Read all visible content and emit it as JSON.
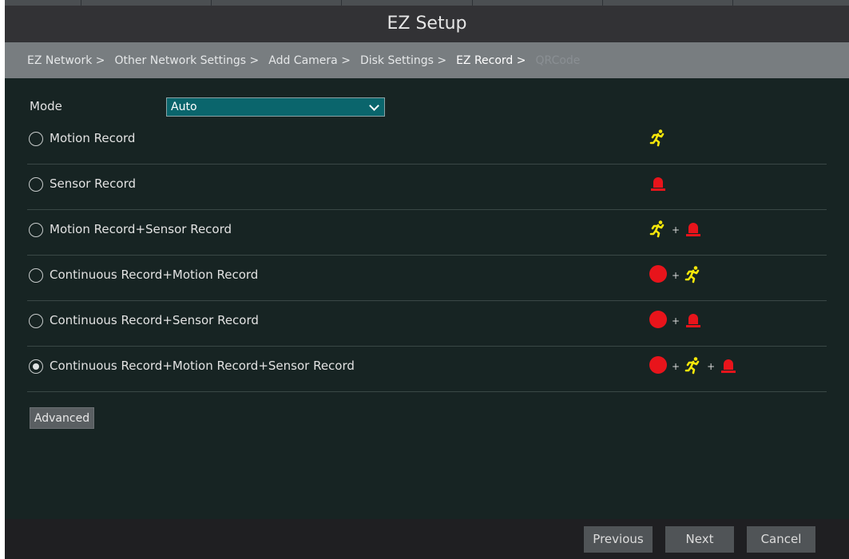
{
  "window": {
    "title": "EZ Setup"
  },
  "breadcrumbs": [
    {
      "label": "EZ Network >",
      "state": "done"
    },
    {
      "label": "Other Network Settings >",
      "state": "done"
    },
    {
      "label": "Add Camera >",
      "state": "done"
    },
    {
      "label": "Disk Settings >",
      "state": "done"
    },
    {
      "label": "EZ Record >",
      "state": "current"
    },
    {
      "label": "QRCode",
      "state": "future"
    }
  ],
  "mode": {
    "label": "Mode",
    "value": "Auto"
  },
  "options": [
    {
      "label": "Motion Record",
      "checked": false,
      "icons": [
        "motion-icon"
      ]
    },
    {
      "label": "Sensor Record",
      "checked": false,
      "icons": [
        "sensor-alarm-icon"
      ]
    },
    {
      "label": "Motion Record+Sensor Record",
      "checked": false,
      "icons": [
        "motion-icon",
        "sensor-alarm-icon"
      ]
    },
    {
      "label": "Continuous Record+Motion Record",
      "checked": false,
      "icons": [
        "continuous-record-icon",
        "motion-icon"
      ]
    },
    {
      "label": "Continuous Record+Sensor Record",
      "checked": false,
      "icons": [
        "continuous-record-icon",
        "sensor-alarm-icon"
      ]
    },
    {
      "label": "Continuous Record+Motion Record+Sensor Record",
      "checked": true,
      "icons": [
        "continuous-record-icon",
        "motion-icon",
        "sensor-alarm-icon"
      ]
    }
  ],
  "icon_join": "+",
  "advanced_label": "Advanced",
  "footer": {
    "previous_label": "Previous",
    "next_label": "Next",
    "cancel_label": "Cancel"
  },
  "colors": {
    "motion": "#f5e60a",
    "alarm": "#e8141b",
    "record": "#e8141b",
    "select_bg": "#0a656c",
    "background": "#172423"
  }
}
